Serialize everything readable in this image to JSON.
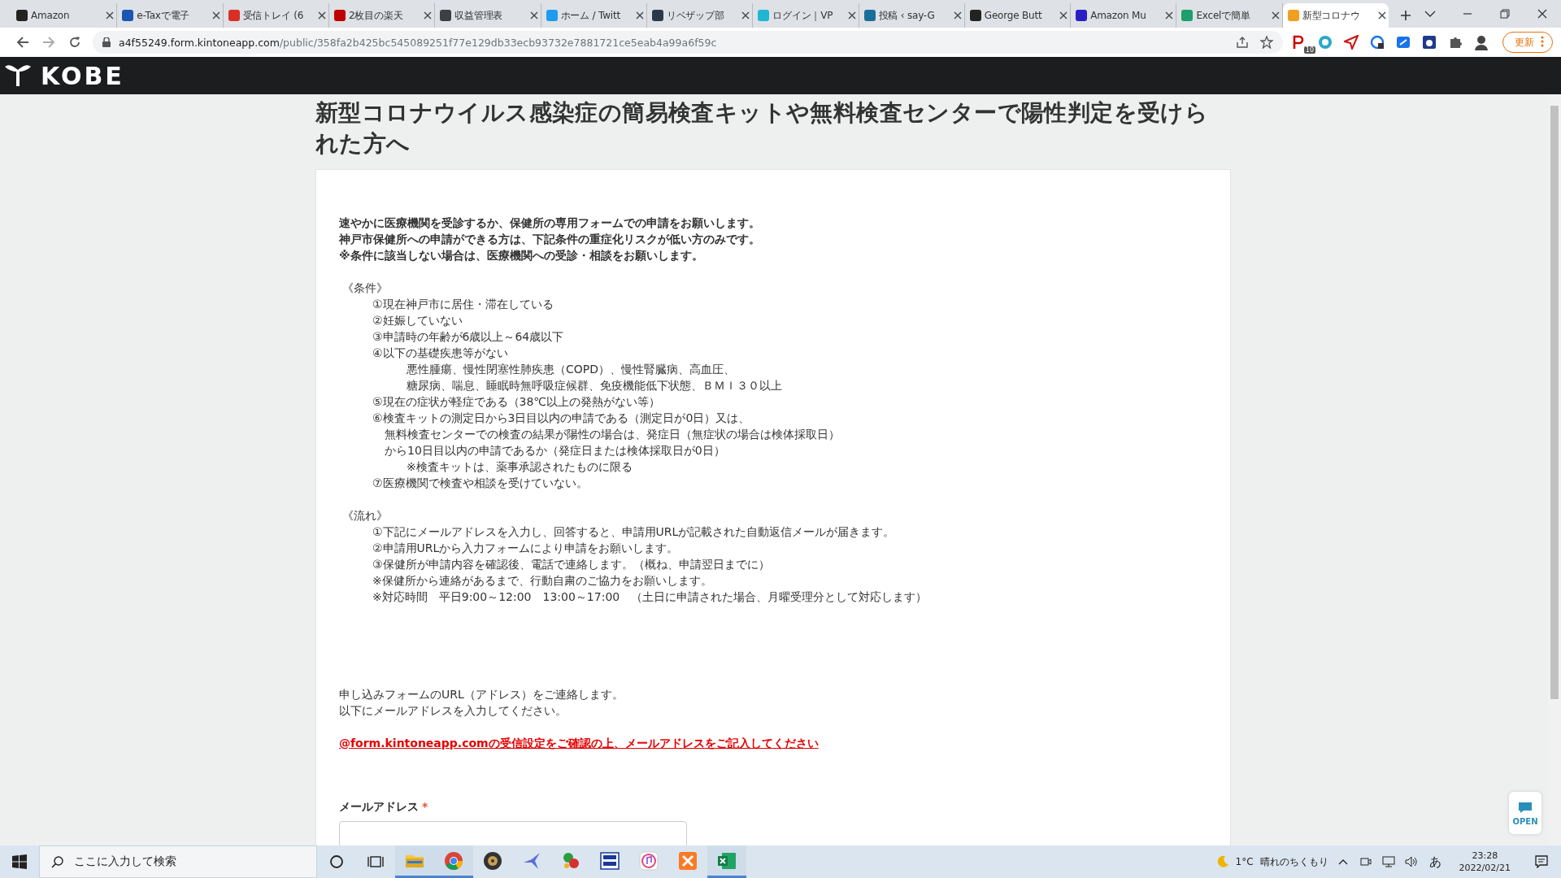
{
  "browser": {
    "tabs": [
      {
        "label": "Amazon",
        "color": "#222222",
        "selected": false
      },
      {
        "label": "e-Taxで電子",
        "color": "#1a56b0",
        "selected": false
      },
      {
        "label": "受信トレイ (6",
        "color": "#d93025",
        "selected": false
      },
      {
        "label": "2枚目の楽天",
        "color": "#bf0000",
        "selected": false
      },
      {
        "label": "収益管理表",
        "color": "#3c4043",
        "selected": false
      },
      {
        "label": "ホーム / Twitt",
        "color": "#1d9bf0",
        "selected": false
      },
      {
        "label": "リベザップ部",
        "color": "#2a3a4a",
        "selected": false
      },
      {
        "label": "ログイン｜VP",
        "color": "#1fb6d4",
        "selected": false
      },
      {
        "label": "投稿 ‹ say-G",
        "color": "#1a6f9a",
        "selected": false
      },
      {
        "label": "George Butt",
        "color": "#222222",
        "selected": false
      },
      {
        "label": "Amazon Mu",
        "color": "#2b1fc4",
        "selected": false
      },
      {
        "label": "Excelで簡単",
        "color": "#1e9e6a",
        "selected": false
      },
      {
        "label": "新型コロナウ",
        "color": "#f0a020",
        "selected": true
      }
    ],
    "url_host": "a4f55249.form.kintoneapp.com",
    "url_path": "/public/358fa2b425bc545089251f77e129db33ecb93732e7881721ce5eab4a99a6f59c",
    "extension_badge": "10",
    "update_button": "更新"
  },
  "header": {
    "logo": "KOBE"
  },
  "page": {
    "title": "新型コロナウイルス感染症の簡易検査キットや無料検査センターで陽性判定を受けられた方へ",
    "intro": [
      "速やかに医療機関を受診するか、保健所の専用フォームでの申請をお願いします。",
      "神戸市保健所への申請ができる方は、下記条件の重症化リスクが低い方のみです。",
      "※条件に該当しない場合は、医療機関への受診・相談をお願いします。"
    ],
    "sections": [
      {
        "heading": "《条件》",
        "lines": [
          {
            "kind": "item",
            "text": "①現在神戸市に居住・滞在している"
          },
          {
            "kind": "item",
            "text": "②妊娠していない"
          },
          {
            "kind": "item",
            "text": "③申請時の年齢が6歳以上～64歳以下"
          },
          {
            "kind": "item",
            "text": "④以下の基礎疾患等がない"
          },
          {
            "kind": "sub",
            "text": "悪性腫瘍、慢性閉塞性肺疾患（COPD）、慢性腎臓病、高血圧、"
          },
          {
            "kind": "sub",
            "text": "糖尿病、喘息、睡眠時無呼吸症候群、免疫機能低下状態、ＢＭＩ３０以上"
          },
          {
            "kind": "item",
            "text": "⑤現在の症状が軽症である（38℃以上の発熱がない等）"
          },
          {
            "kind": "item",
            "text": "⑥検査キットの測定日から3日目以内の申請である（測定日が0日）又は、"
          },
          {
            "kind": "cont",
            "text": "無料検査センターでの検査の結果が陽性の場合は、発症日（無症状の場合は検体採取日）"
          },
          {
            "kind": "cont",
            "text": "から10日目以内の申請であるか（発症日または検体採取日が0日）"
          },
          {
            "kind": "sub",
            "text": "※検査キットは、薬事承認されたものに限る"
          },
          {
            "kind": "item",
            "text": "⑦医療機関で検査や相談を受けていない。"
          }
        ]
      },
      {
        "heading": "《流れ》",
        "lines": [
          {
            "kind": "item",
            "text": "①下記にメールアドレスを入力し、回答すると、申請用URLが記載された自動返信メールが届きます。"
          },
          {
            "kind": "item",
            "text": "②申請用URLから入力フォームにより申請をお願いします。"
          },
          {
            "kind": "item",
            "text": "③保健所が申請内容を確認後、電話で連絡します。（概ね、申請翌日までに）"
          },
          {
            "kind": "item",
            "text": "※保健所から連絡があるまで、行動自粛のご協力をお願いします。"
          },
          {
            "kind": "item",
            "text": "※対応時間　平日9:00～12:00　13:00～17:00　（土日に申請された場合、月曜受理分として対応します）"
          }
        ]
      }
    ],
    "contact": [
      "申し込みフォームのURL（アドレス）をご連絡します。",
      "以下にメールアドレスを入力してください。"
    ],
    "notice_link": "@form.kintoneapp.comの受信設定をご確認の上、メールアドレスをご記入してください",
    "field": {
      "label": "メールアドレス",
      "required_mark": "*"
    }
  },
  "chat_badge": "OPEN",
  "taskbar": {
    "search_placeholder": "ここに入力して検索",
    "apps": [
      {
        "kind": "folder",
        "active": true
      },
      {
        "kind": "chrome",
        "active": true
      },
      {
        "kind": "disc",
        "active": false
      },
      {
        "kind": "bird",
        "active": false
      },
      {
        "kind": "leaf",
        "active": false
      },
      {
        "kind": "tag",
        "active": false
      },
      {
        "kind": "music",
        "active": false
      },
      {
        "kind": "xampp",
        "active": false
      },
      {
        "kind": "excel",
        "active": true
      }
    ],
    "temperature": "1°C",
    "weather": "晴れのちくもり",
    "ime": "あ",
    "time": "23:28",
    "date": "2022/02/21"
  }
}
